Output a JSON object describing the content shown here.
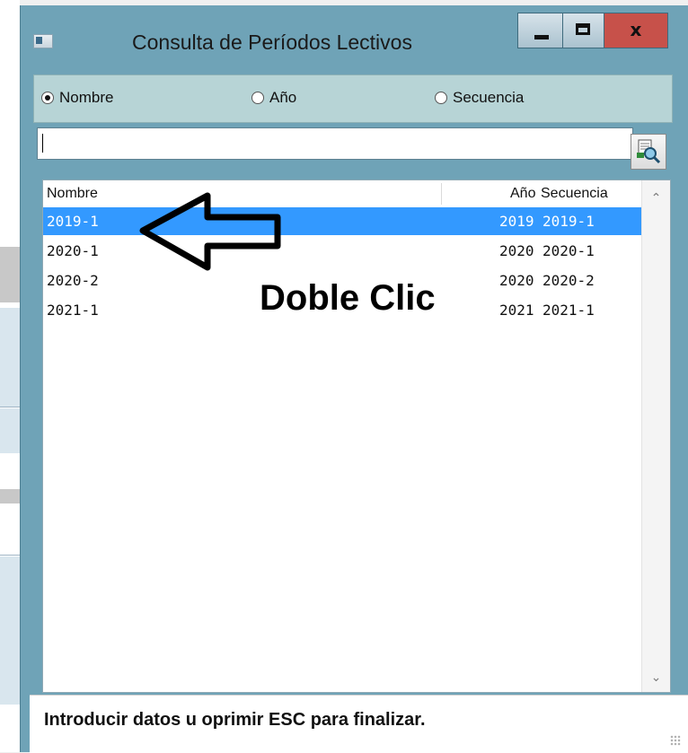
{
  "window": {
    "title": "Consulta de Períodos Lectivos",
    "controls": {
      "minimize": "minimize",
      "maximize": "maximize",
      "close": "x"
    }
  },
  "search_mode": {
    "options": [
      {
        "label": "Nombre",
        "checked": true
      },
      {
        "label": "Año",
        "checked": false
      },
      {
        "label": "Secuencia",
        "checked": false
      }
    ]
  },
  "search": {
    "value": "",
    "button_icon": "search-records-icon"
  },
  "table": {
    "columns": [
      "Nombre",
      "Año",
      "Secuencia"
    ],
    "rows": [
      {
        "nombre": "2019-1",
        "anio": "2019",
        "secuencia": "2019-1",
        "selected": true
      },
      {
        "nombre": "2020-1",
        "anio": "2020",
        "secuencia": "2020-1",
        "selected": false
      },
      {
        "nombre": "2020-2",
        "anio": "2020",
        "secuencia": "2020-2",
        "selected": false
      },
      {
        "nombre": "2021-1",
        "anio": "2021",
        "secuencia": "2021-1",
        "selected": false
      }
    ]
  },
  "annotation": {
    "text": "Doble Clic"
  },
  "status": {
    "text": "Introducir datos u oprimir ESC para finalizar."
  },
  "colors": {
    "title_bar": "#6fa3b7",
    "radio_panel": "#b7d4d6",
    "selection": "#3399ff",
    "close_button": "#c7514a"
  }
}
